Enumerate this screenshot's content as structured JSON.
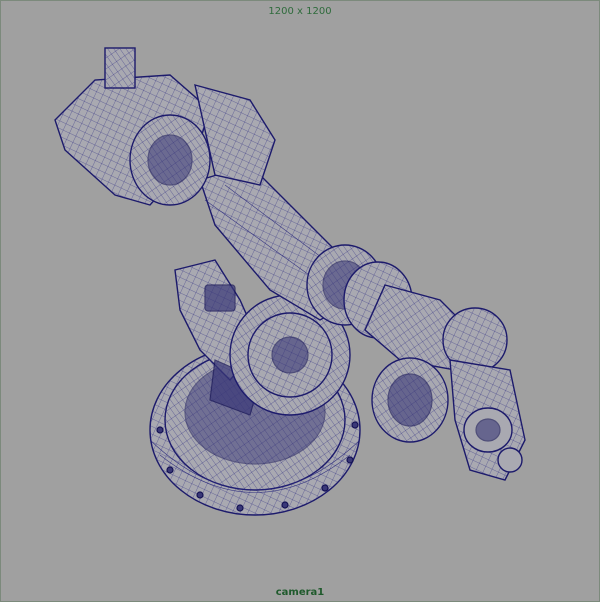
{
  "viewport": {
    "resolution_gate": "1200 x 1200",
    "camera_name": "camera1",
    "background_color": "#a0a0a0",
    "wire_color": "#1c1a6b"
  },
  "model": {
    "icon": "robot-arm-wireframe-icon"
  }
}
